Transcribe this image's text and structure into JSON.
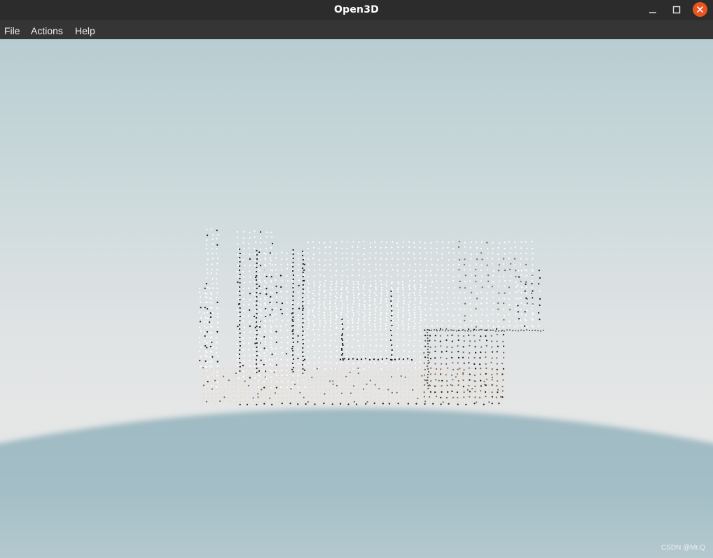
{
  "window": {
    "title": "Open3D"
  },
  "menu": [
    {
      "label": "File"
    },
    {
      "label": "Actions"
    },
    {
      "label": "Help"
    }
  ],
  "window_controls": {
    "minimize": "minimize-icon",
    "maximize": "maximize-icon",
    "close": "close-icon"
  },
  "scene": {
    "sky_color": "#bacdd2",
    "horizon_color": "#e5e6e6",
    "ground_color": "#a3bec6",
    "close_button_color": "#e9541f",
    "point_colors": [
      "#ffffff",
      "#1a1a1a",
      "#f2d6bf",
      "#7a6a5a"
    ]
  },
  "watermark": "CSDN @Mr.Q"
}
